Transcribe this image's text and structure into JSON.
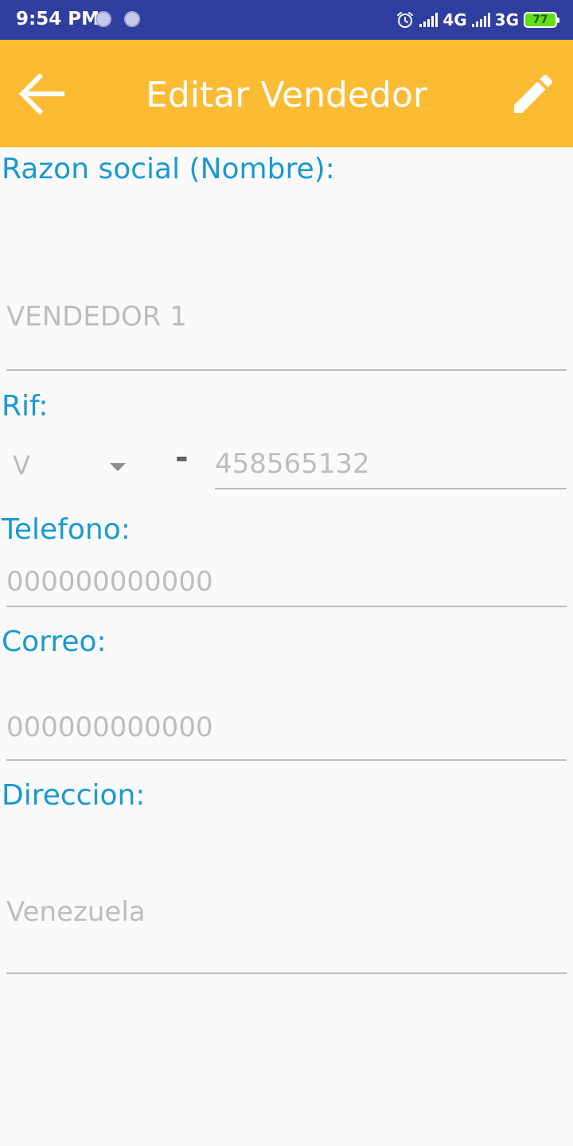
{
  "status_bar": {
    "time": "9:54 PM",
    "network_1": "4G",
    "network_2": "3G",
    "battery_level": "77",
    "icons": [
      "notification-dot-icon",
      "notification-dot-icon",
      "alarm-icon",
      "signal-icon",
      "signal-icon",
      "battery-icon"
    ],
    "background_color": "#303f9f"
  },
  "toolbar": {
    "title": "Editar Vendedor",
    "back_icon": "arrow-back-icon",
    "edit_icon": "pencil-icon",
    "background_color": "#fbbc33"
  },
  "form": {
    "label_color": "#1a9ad0",
    "razon_social": {
      "label": "Razon social (Nombre):",
      "value": "VENDEDOR 1"
    },
    "rif": {
      "label": "Rif:",
      "type_value": "V",
      "separator": "-",
      "number_value": "458565132"
    },
    "telefono": {
      "label": "Telefono:",
      "value": "000000000000"
    },
    "correo": {
      "label": "Correo:",
      "value": "000000000000"
    },
    "direccion": {
      "label": "Direccion:",
      "value": "Venezuela"
    }
  }
}
